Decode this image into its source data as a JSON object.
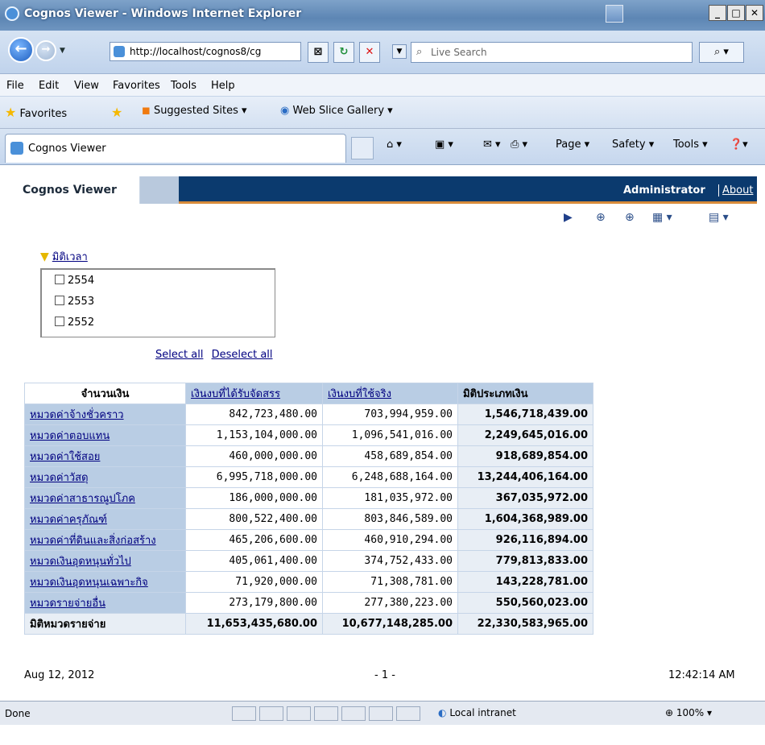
{
  "window": {
    "title": "Cognos Viewer - Windows Internet Explorer"
  },
  "nav": {
    "url_prefix": "http://",
    "url_host": "localhost",
    "url_rest": "/cognos8/cg",
    "search_placeholder": "Live Search"
  },
  "menu": [
    "File",
    "Edit",
    "View",
    "Favorites",
    "Tools",
    "Help"
  ],
  "favbar": {
    "favorites": "Favorites",
    "suggested": "Suggested Sites ▾",
    "webslice": "Web Slice Gallery ▾"
  },
  "tab": {
    "label": "Cognos Viewer"
  },
  "commands": {
    "page": "Page ▾",
    "safety": "Safety ▾",
    "tools": "Tools ▾"
  },
  "viewer": {
    "title": "Cognos Viewer",
    "user": "Administrator",
    "about": "About"
  },
  "filter": {
    "title": "มิติเวลา",
    "options": [
      "2554",
      "2553",
      "2552"
    ],
    "select_all": "Select all",
    "deselect_all": "Deselect all"
  },
  "crosstab": {
    "corner": "จำนวนเงิน",
    "columns": [
      "เงินงบที่ได้รับจัดสรร",
      "เงินงบที่ใช้จริง",
      "มิติประเภทเงิน"
    ],
    "rows": [
      {
        "label": "หมวดค่าจ้างชั่วคราว",
        "values": [
          "842,723,480.00",
          "703,994,959.00",
          "1,546,718,439.00"
        ]
      },
      {
        "label": "หมวดค่าตอบแทน",
        "values": [
          "1,153,104,000.00",
          "1,096,541,016.00",
          "2,249,645,016.00"
        ]
      },
      {
        "label": "หมวดค่าใช้สอย",
        "values": [
          "460,000,000.00",
          "458,689,854.00",
          "918,689,854.00"
        ]
      },
      {
        "label": "หมวดค่าวัสดุ",
        "values": [
          "6,995,718,000.00",
          "6,248,688,164.00",
          "13,244,406,164.00"
        ]
      },
      {
        "label": "หมวดค่าสาธารณูปโภค",
        "values": [
          "186,000,000.00",
          "181,035,972.00",
          "367,035,972.00"
        ]
      },
      {
        "label": "หมวดค่าครุภัณฑ์",
        "values": [
          "800,522,400.00",
          "803,846,589.00",
          "1,604,368,989.00"
        ]
      },
      {
        "label": "หมวดค่าที่ดินและสิ่งก่อสร้าง",
        "values": [
          "465,206,600.00",
          "460,910,294.00",
          "926,116,894.00"
        ]
      },
      {
        "label": "หมวดเงินอุดหนุนทั่วไป",
        "values": [
          "405,061,400.00",
          "374,752,433.00",
          "779,813,833.00"
        ]
      },
      {
        "label": "หมวดเงินอุดหนุนเฉพาะกิจ",
        "values": [
          "71,920,000.00",
          "71,308,781.00",
          "143,228,781.00"
        ]
      },
      {
        "label": "หมวดรายจ่ายอื่น",
        "values": [
          "273,179,800.00",
          "277,380,223.00",
          "550,560,023.00"
        ]
      }
    ],
    "total": {
      "label": "มิติหมวดรายจ่าย",
      "values": [
        "11,653,435,680.00",
        "10,677,148,285.00",
        "22,330,583,965.00"
      ]
    }
  },
  "footer": {
    "date": "Aug 12, 2012",
    "page": "- 1 -",
    "time": "12:42:14 AM"
  },
  "status": {
    "text": "Done",
    "zone": "Local intranet",
    "zoom": "100%"
  }
}
